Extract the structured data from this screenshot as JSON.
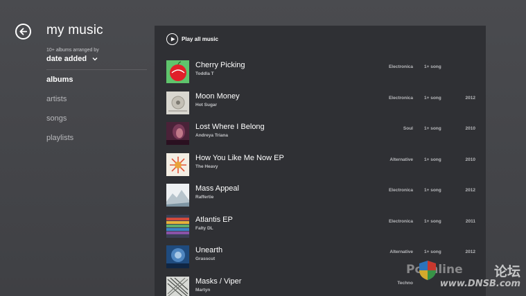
{
  "header": {
    "back_icon": "back-arrow-icon",
    "title": "my music",
    "arranged_caption": "10+ albums arranged by",
    "sort_value": "date added"
  },
  "nav": {
    "items": [
      {
        "label": "albums",
        "active": true
      },
      {
        "label": "artists",
        "active": false
      },
      {
        "label": "songs",
        "active": false
      },
      {
        "label": "playlists",
        "active": false
      }
    ]
  },
  "main": {
    "play_all_label": "Play all music",
    "albums": [
      {
        "title": "Cherry Picking",
        "artist": "Toddla T",
        "genre": "Electronica",
        "count": "1+ song",
        "year": ""
      },
      {
        "title": "Moon Money",
        "artist": "Hot Sugar",
        "genre": "Electronica",
        "count": "1+ song",
        "year": "2012"
      },
      {
        "title": "Lost Where I Belong",
        "artist": "Andreya Triana",
        "genre": "Soul",
        "count": "1+ song",
        "year": "2010"
      },
      {
        "title": "How You Like Me Now EP",
        "artist": "The Heavy",
        "genre": "Alternative",
        "count": "1+ song",
        "year": "2010"
      },
      {
        "title": "Mass Appeal",
        "artist": "Raffertie",
        "genre": "Electronica",
        "count": "1+ song",
        "year": "2012"
      },
      {
        "title": "Atlantis EP",
        "artist": "Falty DL",
        "genre": "Electronica",
        "count": "1+ song",
        "year": "2011"
      },
      {
        "title": "Unearth",
        "artist": "Grasscut",
        "genre": "Alternative",
        "count": "1+ song",
        "year": "2012"
      },
      {
        "title": "Masks / Viper",
        "artist": "Martyn",
        "genre": "Techno",
        "count": "",
        "year": ""
      }
    ]
  },
  "watermark": {
    "brand": "Pconline",
    "forum": "论坛",
    "url": "www.DNSB.com"
  },
  "colors": {
    "background": "#48494d",
    "panel": "#2f3034",
    "text_primary": "#ffffff",
    "text_secondary": "#b8b9bc"
  }
}
